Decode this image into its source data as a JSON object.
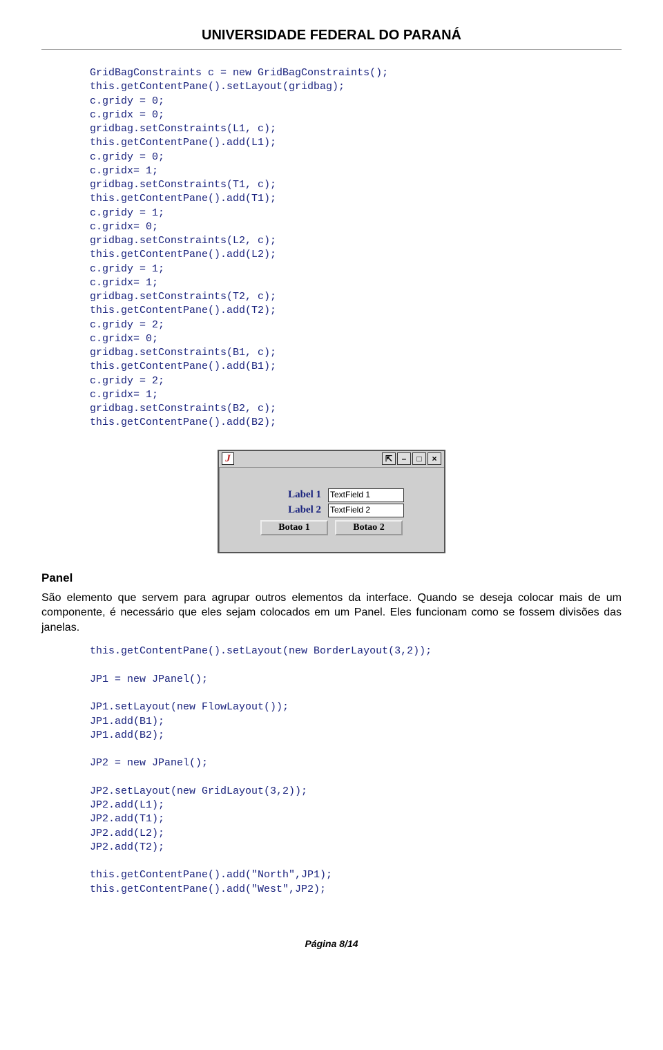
{
  "header": "UNIVERSIDADE FEDERAL DO PARANÁ",
  "code1": "GridBagConstraints c = new GridBagConstraints();\nthis.getContentPane().setLayout(gridbag);\nc.gridy = 0;\nc.gridx = 0;\ngridbag.setConstraints(L1, c);\nthis.getContentPane().add(L1);\nc.gridy = 0;\nc.gridx= 1;\ngridbag.setConstraints(T1, c);\nthis.getContentPane().add(T1);\nc.gridy = 1;\nc.gridx= 0;\ngridbag.setConstraints(L2, c);\nthis.getContentPane().add(L2);\nc.gridy = 1;\nc.gridx= 1;\ngridbag.setConstraints(T2, c);\nthis.getContentPane().add(T2);\nc.gridy = 2;\nc.gridx= 0;\ngridbag.setConstraints(B1, c);\nthis.getContentPane().add(B1);\nc.gridy = 2;\nc.gridx= 1;\ngridbag.setConstraints(B2, c);\nthis.getContentPane().add(B2);",
  "window": {
    "icon_char": "J",
    "btn_pin": "⇱",
    "btn_min": "–",
    "btn_max": "□",
    "btn_close": "×",
    "label1": "Label 1",
    "label2": "Label 2",
    "tf1": "TextField 1",
    "tf2": "TextField 2",
    "btn1": "Botao 1",
    "btn2": "Botao 2"
  },
  "panel_title": "Panel",
  "panel_text": "São elemento que servem para agrupar outros elementos da interface. Quando se deseja colocar mais de um componente, é necessário que eles sejam colocados em um Panel. Eles funcionam como se fossem divisões das janelas.",
  "code2": "this.getContentPane().setLayout(new BorderLayout(3,2));\n\nJP1 = new JPanel();\n\nJP1.setLayout(new FlowLayout());\nJP1.add(B1);\nJP1.add(B2);\n\nJP2 = new JPanel();\n\nJP2.setLayout(new GridLayout(3,2));\nJP2.add(L1);\nJP2.add(T1);\nJP2.add(L2);\nJP2.add(T2);\n\nthis.getContentPane().add(\"North\",JP1);\nthis.getContentPane().add(\"West\",JP2);",
  "footer": "Página 8/14"
}
